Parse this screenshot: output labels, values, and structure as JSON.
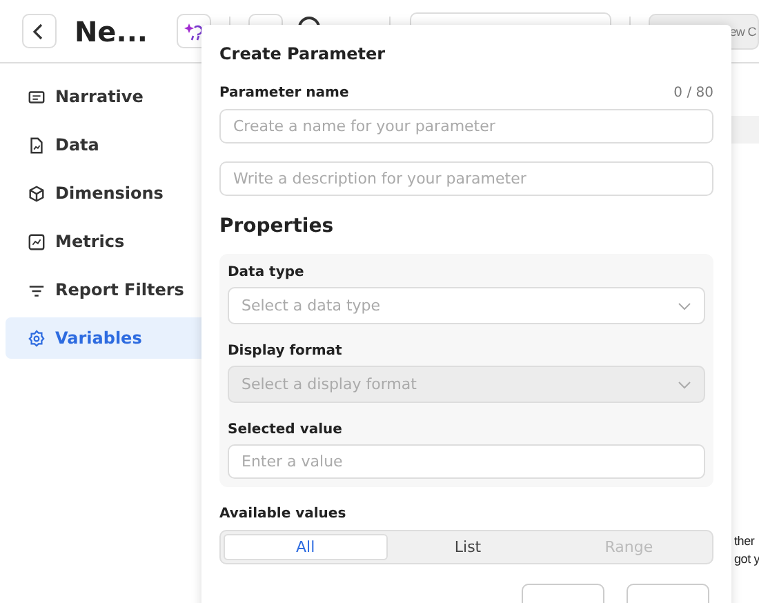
{
  "header": {
    "title": "Ne...",
    "cut_button": "ew C"
  },
  "sidebar": {
    "items": [
      {
        "label": "Narrative",
        "selected": false
      },
      {
        "label": "Data",
        "selected": false
      },
      {
        "label": "Dimensions",
        "selected": false
      },
      {
        "label": "Metrics",
        "selected": false
      },
      {
        "label": "Report Filters",
        "selected": false
      },
      {
        "label": "Variables",
        "selected": true
      }
    ]
  },
  "background_text": [
    "ther",
    "got y"
  ],
  "dialog": {
    "title": "Create Parameter",
    "name_field": {
      "label": "Parameter name",
      "counter": "0 / 80",
      "placeholder": "Create a name for your parameter"
    },
    "description_field": {
      "placeholder": "Write a description for your parameter"
    },
    "properties_title": "Properties",
    "properties": [
      {
        "kind": "select",
        "label": "Data type",
        "placeholder": "Select a data type",
        "disabled": false
      },
      {
        "kind": "select",
        "label": "Display format",
        "placeholder": "Select a display format",
        "disabled": true
      },
      {
        "kind": "input",
        "label": "Selected value",
        "placeholder": "Enter a value",
        "disabled": false
      }
    ],
    "available_values": {
      "label": "Available values",
      "options": [
        {
          "label": "All",
          "selected": true,
          "disabled": false
        },
        {
          "label": "List",
          "selected": false,
          "disabled": false
        },
        {
          "label": "Range",
          "selected": false,
          "disabled": true
        }
      ]
    }
  }
}
